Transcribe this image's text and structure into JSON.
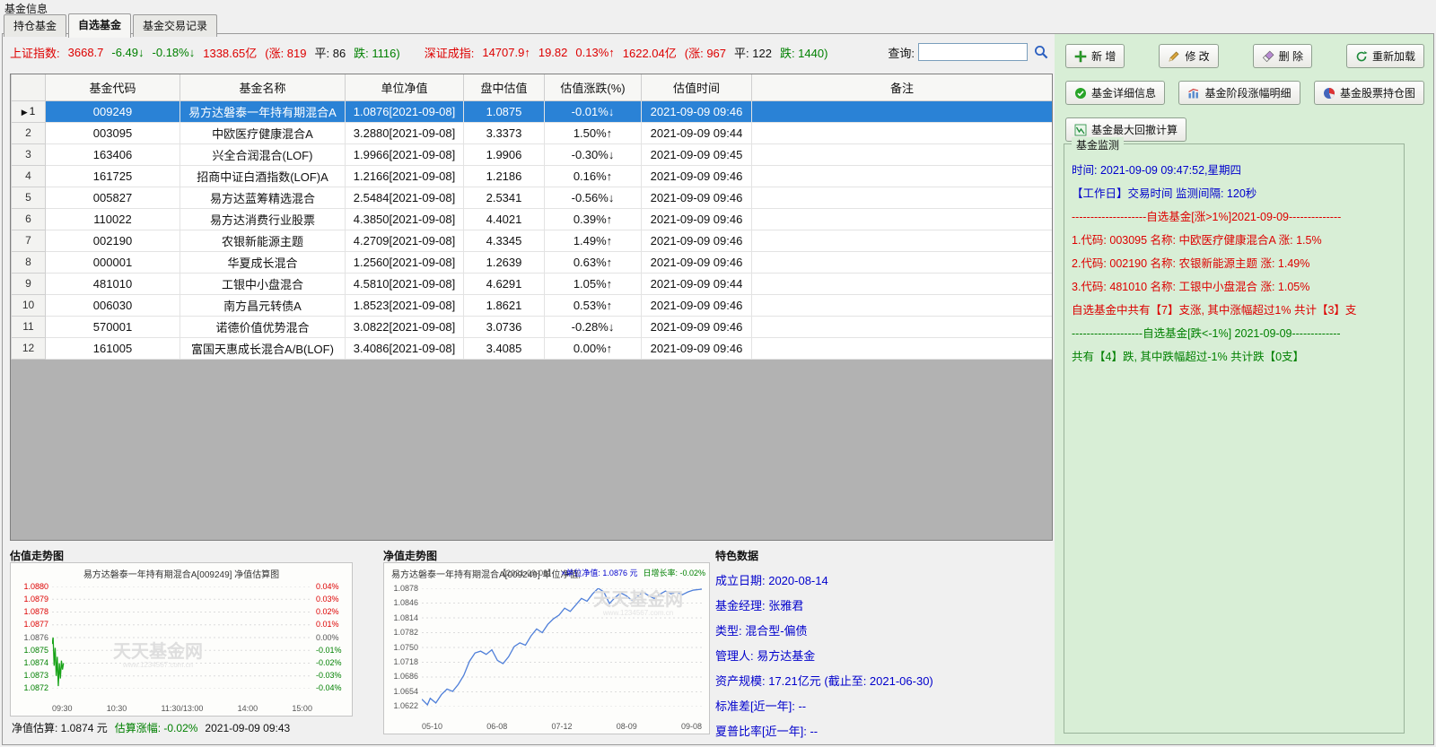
{
  "window": {
    "title": "基金信息"
  },
  "tabs": [
    {
      "label": "持仓基金",
      "active": false
    },
    {
      "label": "自选基金",
      "active": true
    },
    {
      "label": "基金交易记录",
      "active": false
    }
  ],
  "colors": {
    "up": "#dd0000",
    "down": "#008000",
    "selection": "#2a82d6",
    "panel_green": "#d8eed6",
    "link_blue": "#0000cc"
  },
  "index_bar": {
    "sh_segments": [
      {
        "t": "上证指数:",
        "c": "up"
      },
      {
        "t": "3668.7",
        "c": "up"
      },
      {
        "t": "-6.49↓",
        "c": "down"
      },
      {
        "t": "-0.18%↓",
        "c": "down"
      },
      {
        "t": "1338.65亿",
        "c": "up"
      },
      {
        "t": "(涨: 819",
        "c": "up"
      },
      {
        "t": "平: 86",
        "c": "black"
      },
      {
        "t": "跌: 1116)",
        "c": "down"
      }
    ],
    "sz_segments": [
      {
        "t": "深证成指:",
        "c": "up"
      },
      {
        "t": "14707.9↑",
        "c": "up"
      },
      {
        "t": "19.82",
        "c": "up"
      },
      {
        "t": "0.13%↑",
        "c": "up"
      },
      {
        "t": "1622.04亿",
        "c": "up"
      },
      {
        "t": "(涨: 967",
        "c": "up"
      },
      {
        "t": "平: 122",
        "c": "black"
      },
      {
        "t": "跌: 1440)",
        "c": "down"
      }
    ],
    "search_label": "查询:",
    "search_value": ""
  },
  "toolbar": {
    "add": "新 增",
    "modify": "修 改",
    "delete": "删 除",
    "reload": "重新加载",
    "detail": "基金详细信息",
    "stage": "基金阶段涨幅明细",
    "holdings": "基金股票持仓图",
    "drawdown": "基金最大回撤计算"
  },
  "table": {
    "headers": [
      "基金代码",
      "基金名称",
      "单位净值",
      "盘中估值",
      "估值涨跌(%)",
      "估值时间",
      "备注"
    ],
    "rows": [
      {
        "num": "1",
        "code": "009249",
        "name": "易方达磐泰一年持有期混合A",
        "nav": "1.0876[2021-09-08]",
        "est": "1.0875",
        "chg": "-0.01%↓",
        "chg_dir": "down",
        "time": "2021-09-09 09:46",
        "remark": "",
        "selected": true
      },
      {
        "num": "2",
        "code": "003095",
        "name": "中欧医疗健康混合A",
        "nav": "3.2880[2021-09-08]",
        "est": "3.3373",
        "chg": "1.50%↑",
        "chg_dir": "up",
        "time": "2021-09-09 09:44",
        "remark": "",
        "selected": false
      },
      {
        "num": "3",
        "code": "163406",
        "name": "兴全合润混合(LOF)",
        "nav": "1.9966[2021-09-08]",
        "est": "1.9906",
        "chg": "-0.30%↓",
        "chg_dir": "down",
        "time": "2021-09-09 09:45",
        "remark": "",
        "selected": false
      },
      {
        "num": "4",
        "code": "161725",
        "name": "招商中证白酒指数(LOF)A",
        "nav": "1.2166[2021-09-08]",
        "est": "1.2186",
        "chg": "0.16%↑",
        "chg_dir": "up",
        "time": "2021-09-09 09:46",
        "remark": "",
        "selected": false
      },
      {
        "num": "5",
        "code": "005827",
        "name": "易方达蓝筹精选混合",
        "nav": "2.5484[2021-09-08]",
        "est": "2.5341",
        "chg": "-0.56%↓",
        "chg_dir": "down",
        "time": "2021-09-09 09:46",
        "remark": "",
        "selected": false
      },
      {
        "num": "6",
        "code": "110022",
        "name": "易方达消费行业股票",
        "nav": "4.3850[2021-09-08]",
        "est": "4.4021",
        "chg": "0.39%↑",
        "chg_dir": "up",
        "time": "2021-09-09 09:46",
        "remark": "",
        "selected": false
      },
      {
        "num": "7",
        "code": "002190",
        "name": "农银新能源主题",
        "nav": "4.2709[2021-09-08]",
        "est": "4.3345",
        "chg": "1.49%↑",
        "chg_dir": "up",
        "time": "2021-09-09 09:46",
        "remark": "",
        "selected": false
      },
      {
        "num": "8",
        "code": "000001",
        "name": "华夏成长混合",
        "nav": "1.2560[2021-09-08]",
        "est": "1.2639",
        "chg": "0.63%↑",
        "chg_dir": "up",
        "time": "2021-09-09 09:46",
        "remark": "",
        "selected": false
      },
      {
        "num": "9",
        "code": "481010",
        "name": "工银中小盘混合",
        "nav": "4.5810[2021-09-08]",
        "est": "4.6291",
        "chg": "1.05%↑",
        "chg_dir": "up",
        "time": "2021-09-09 09:44",
        "remark": "",
        "selected": false
      },
      {
        "num": "10",
        "code": "006030",
        "name": "南方昌元转债A",
        "nav": "1.8523[2021-09-08]",
        "est": "1.8621",
        "chg": "0.53%↑",
        "chg_dir": "up",
        "time": "2021-09-09 09:46",
        "remark": "",
        "selected": false
      },
      {
        "num": "11",
        "code": "570001",
        "name": "诺德价值优势混合",
        "nav": "3.0822[2021-09-08]",
        "est": "3.0736",
        "chg": "-0.28%↓",
        "chg_dir": "down",
        "time": "2021-09-09 09:46",
        "remark": "",
        "selected": false
      },
      {
        "num": "12",
        "code": "161005",
        "name": "富国天惠成长混合A/B(LOF)",
        "nav": "3.4086[2021-09-08]",
        "est": "3.4085",
        "chg": "0.00%↑",
        "chg_dir": "up",
        "time": "2021-09-09 09:46",
        "remark": "",
        "selected": false
      }
    ]
  },
  "sections": {
    "est_chart_label": "估值走势图",
    "nav_chart_label": "净值走势图",
    "featured_label": "特色数据"
  },
  "featured": {
    "lines": [
      "成立日期: 2020-08-14",
      "基金经理: 张雅君",
      "类型: 混合型-偏债",
      "管理人: 易方达基金",
      "资产规模: 17.21亿元 (截止至: 2021-06-30)",
      "标准差[近一年]: --",
      "夏普比率[近一年]: --"
    ]
  },
  "monitor": {
    "title": "基金监测",
    "lines": [
      {
        "t": "时间: 2021-09-09 09:47:52,星期四",
        "c": "blue"
      },
      {
        "t": "【工作日】交易时间 监测间隔: 120秒",
        "c": "blue"
      },
      {
        "t": "--------------------自选基金[涨>1%]2021-09-09--------------",
        "c": "up"
      },
      {
        "t": "1.代码: 003095 名称: 中欧医疗健康混合A   涨: 1.5%",
        "c": "up"
      },
      {
        "t": "2.代码: 002190 名称: 农银新能源主题   涨: 1.49%",
        "c": "up"
      },
      {
        "t": "3.代码: 481010 名称: 工银中小盘混合   涨: 1.05%",
        "c": "up"
      },
      {
        "t": "自选基金中共有【7】支涨, 其中涨幅超过1% 共计【3】支",
        "c": "up"
      },
      {
        "t": "-------------------自选基金[跌<-1%] 2021-09-09-------------",
        "c": "down"
      },
      {
        "t": "共有【4】跌, 其中跌幅超过-1% 共计跌【0支】",
        "c": "down"
      }
    ]
  },
  "chart_data": [
    {
      "id": "estimate",
      "type": "line",
      "title": "易方达磐泰一年持有期混合A[009249] 净值估算图",
      "color": "#18a318",
      "yrange": [
        1.0872,
        1.088
      ],
      "ylabels_left": [
        "1.0880",
        "1.0879",
        "1.0878",
        "1.0877",
        "1.0876",
        "1.0875",
        "1.0874",
        "1.0873",
        "1.0872"
      ],
      "ylabels_right": [
        "0.04%",
        "0.03%",
        "0.02%",
        "0.01%",
        "0.00%",
        "-0.01%",
        "-0.02%",
        "-0.03%",
        "-0.04%"
      ],
      "label_tones": [
        "u",
        "u",
        "u",
        "u",
        "n",
        "d",
        "d",
        "d",
        "d"
      ],
      "xlabels": [
        "09:30",
        "10:30",
        "11:30/13:00",
        "14:00",
        "15:00"
      ],
      "series": [
        [
          0.0,
          1.08755
        ],
        [
          0.004,
          1.0876
        ],
        [
          0.008,
          1.08738
        ],
        [
          0.012,
          1.08752
        ],
        [
          0.016,
          1.0873
        ],
        [
          0.02,
          1.08745
        ],
        [
          0.024,
          1.08722
        ],
        [
          0.028,
          1.0874
        ],
        [
          0.032,
          1.08728
        ],
        [
          0.036,
          1.08742
        ],
        [
          0.04,
          1.08735
        ],
        [
          0.044,
          1.0874
        ]
      ],
      "watermark": "天天基金网",
      "watermark_sub": "www.1234567.com.cn",
      "footer": [
        {
          "t": "净值估算: 1.0874 元",
          "c": "black"
        },
        {
          "t": "估算涨幅: -0.02%",
          "c": "down"
        },
        {
          "t": "2021-09-09 09:43",
          "c": "black"
        }
      ]
    },
    {
      "id": "nav",
      "type": "line",
      "title": "易方达磐泰一年持有期混合A[009249] 单位净值走势图",
      "legend": [
        {
          "t": "【2021-09-08】",
          "c": "gray"
        },
        {
          "t": "×单位净值: 1.0876 元",
          "c": "blue"
        },
        {
          "t": "日增长率: -0.02%",
          "c": "down"
        }
      ],
      "color": "#4f7fd9",
      "yrange": [
        1.0622,
        1.0878
      ],
      "ylabels_left": [
        "1.0878",
        "1.0846",
        "1.0814",
        "1.0782",
        "1.0750",
        "1.0718",
        "1.0686",
        "1.0654",
        "1.0622"
      ],
      "label_tones": [
        "n",
        "n",
        "n",
        "n",
        "n",
        "n",
        "n",
        "n",
        "n"
      ],
      "xlabels": [
        "05-10",
        "06-08",
        "07-12",
        "08-09",
        "09-08"
      ],
      "series": [
        [
          0.0,
          1.0638
        ],
        [
          0.02,
          1.0626
        ],
        [
          0.03,
          1.064
        ],
        [
          0.05,
          1.063
        ],
        [
          0.07,
          1.0648
        ],
        [
          0.09,
          1.066
        ],
        [
          0.11,
          1.0655
        ],
        [
          0.13,
          1.067
        ],
        [
          0.15,
          1.069
        ],
        [
          0.17,
          1.072
        ],
        [
          0.19,
          1.0738
        ],
        [
          0.21,
          1.0742
        ],
        [
          0.23,
          1.0735
        ],
        [
          0.25,
          1.0745
        ],
        [
          0.27,
          1.0722
        ],
        [
          0.29,
          1.0715
        ],
        [
          0.31,
          1.073
        ],
        [
          0.33,
          1.0752
        ],
        [
          0.35,
          1.076
        ],
        [
          0.37,
          1.0755
        ],
        [
          0.39,
          1.0775
        ],
        [
          0.41,
          1.079
        ],
        [
          0.43,
          1.0782
        ],
        [
          0.45,
          1.08
        ],
        [
          0.47,
          1.0812
        ],
        [
          0.49,
          1.082
        ],
        [
          0.51,
          1.0835
        ],
        [
          0.53,
          1.0828
        ],
        [
          0.55,
          1.0842
        ],
        [
          0.57,
          1.0856
        ],
        [
          0.59,
          1.085
        ],
        [
          0.61,
          1.0866
        ],
        [
          0.63,
          1.0878
        ],
        [
          0.65,
          1.087
        ],
        [
          0.67,
          1.0845
        ],
        [
          0.69,
          1.0858
        ],
        [
          0.71,
          1.0868
        ],
        [
          0.73,
          1.0862
        ],
        [
          0.75,
          1.0852
        ],
        [
          0.77,
          1.086
        ],
        [
          0.79,
          1.087
        ],
        [
          0.81,
          1.0862
        ],
        [
          0.83,
          1.0856
        ],
        [
          0.85,
          1.0865
        ],
        [
          0.87,
          1.0872
        ],
        [
          0.89,
          1.0866
        ],
        [
          0.91,
          1.087
        ],
        [
          0.93,
          1.0864
        ],
        [
          0.95,
          1.087
        ],
        [
          0.97,
          1.0874
        ],
        [
          1.0,
          1.0876
        ]
      ],
      "watermark": "天天基金网",
      "watermark_sub": "www.1234567.com.cn"
    }
  ]
}
